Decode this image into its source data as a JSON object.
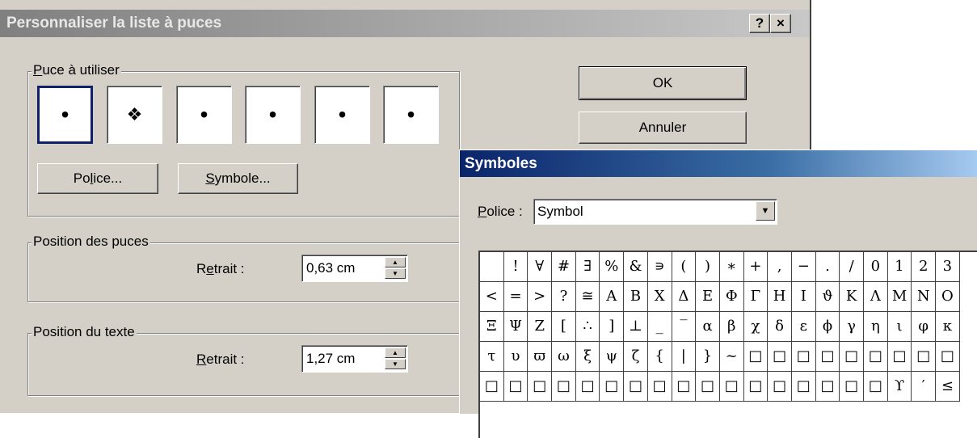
{
  "bullet_dialog": {
    "title": "Personnaliser la liste à puces",
    "help_button": "?",
    "close_button": "×",
    "bullet_group": {
      "label_first": "P",
      "label_rest": "uce à utiliser",
      "bullets": [
        "•",
        "❖",
        "•",
        "•",
        "•",
        "•"
      ],
      "selected_index": 0
    },
    "police_button": {
      "pre": "Po",
      "acc": "l",
      "post": "ice..."
    },
    "symbole_button": {
      "acc": "S",
      "post": "ymbole..."
    },
    "ok_button": "OK",
    "cancel_button": "Annuler",
    "position_puces": {
      "label": "Position des puces",
      "retrait_pre": "R",
      "retrait_acc": "e",
      "retrait_post": "trait :",
      "value": "0,63 cm"
    },
    "position_texte": {
      "label": "Position du texte",
      "retrait_acc": "R",
      "retrait_post": "etrait :",
      "value": "1,27 cm"
    }
  },
  "symbol_dialog": {
    "title": "Symboles",
    "font_label_acc": "P",
    "font_label_rest": "olice :",
    "font_value": "Symbol",
    "grid": [
      [
        " ",
        "!",
        "∀",
        "#",
        "∃",
        "%",
        "&",
        "∍",
        "(",
        ")",
        "∗",
        "+",
        ",",
        "−",
        ".",
        "/",
        "0",
        "1",
        "2",
        "3"
      ],
      [
        "<",
        "=",
        ">",
        "?",
        "≅",
        "Α",
        "Β",
        "Χ",
        "Δ",
        "Ε",
        "Φ",
        "Γ",
        "Η",
        "Ι",
        "ϑ",
        "Κ",
        "Λ",
        "Μ",
        "Ν",
        "Ο"
      ],
      [
        "Ξ",
        "Ψ",
        "Ζ",
        "[",
        "∴",
        "]",
        "⊥",
        "_",
        "‾",
        "α",
        "β",
        "χ",
        "δ",
        "ε",
        "ϕ",
        "γ",
        "η",
        "ι",
        "φ",
        "κ"
      ],
      [
        "τ",
        "υ",
        "ϖ",
        "ω",
        "ξ",
        "ψ",
        "ζ",
        "{",
        "|",
        "}",
        "~",
        "□",
        "□",
        "□",
        "□",
        "□",
        "□",
        "□",
        "□",
        "□"
      ],
      [
        "□",
        "□",
        "□",
        "□",
        "□",
        "□",
        "□",
        "□",
        "□",
        "□",
        "□",
        "□",
        "□",
        "□",
        "□",
        "□",
        "□",
        "ϒ",
        "′",
        "≤"
      ]
    ]
  }
}
